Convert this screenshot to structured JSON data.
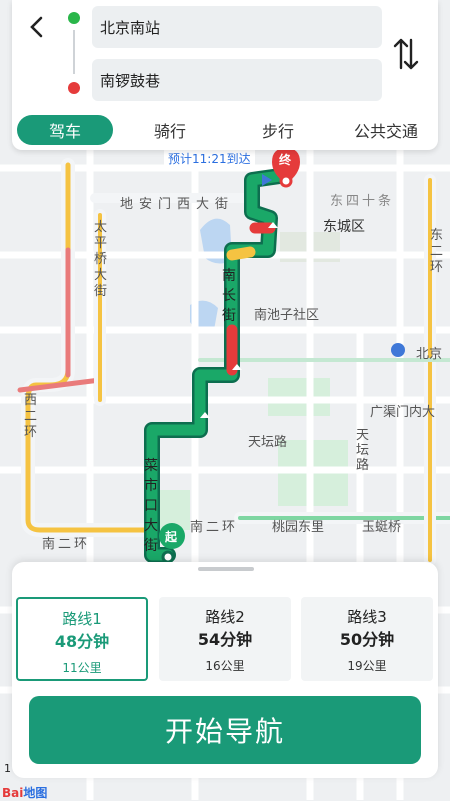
{
  "search": {
    "start": "北京南站",
    "end": "南锣鼓巷"
  },
  "tabs": [
    {
      "label": "驾车",
      "active": true
    },
    {
      "label": "骑行",
      "active": false
    },
    {
      "label": "步行",
      "active": false
    },
    {
      "label": "公共交通",
      "active": false
    }
  ],
  "map": {
    "eta_label": "预计11:21到达",
    "end_marker": "终",
    "start_marker": "起",
    "labels": {
      "dianmen": "地安门西大街",
      "dongsishitiao": "东四十条",
      "dongcheng": "东城区",
      "taipingqiao": "太平桥大街",
      "nanchang": "南长街",
      "nanchizi": "南池子社区",
      "beijing": "北京",
      "guangqumen": "广渠门内大",
      "tiantanlu": "天坛路",
      "tiantanlu2": "天坛路",
      "xierhuan": "西二环",
      "dongerhuan": "东二环",
      "caishikou": "菜市口大街",
      "nanerhuan": "南二环",
      "taoyuan": "桃园东里",
      "yutingqiao": "玉蜓桥",
      "nanerhuan_left": "南二环"
    }
  },
  "routes": [
    {
      "name": "路线1",
      "time": "48分钟",
      "distance": "11公里",
      "active": true
    },
    {
      "name": "路线2",
      "time": "54分钟",
      "distance": "16公里",
      "active": false
    },
    {
      "name": "路线3",
      "time": "50分钟",
      "distance": "19公里",
      "active": false
    }
  ],
  "action": {
    "start_navigation": "开始导航"
  },
  "footer": {
    "scale": "1",
    "logo_bai": "Bai",
    "logo_du": "地图"
  },
  "colors": {
    "accent": "#1a9a78",
    "route_green": "#1aa868",
    "traffic_red": "#e53b3b",
    "traffic_yellow": "#f5c342"
  }
}
